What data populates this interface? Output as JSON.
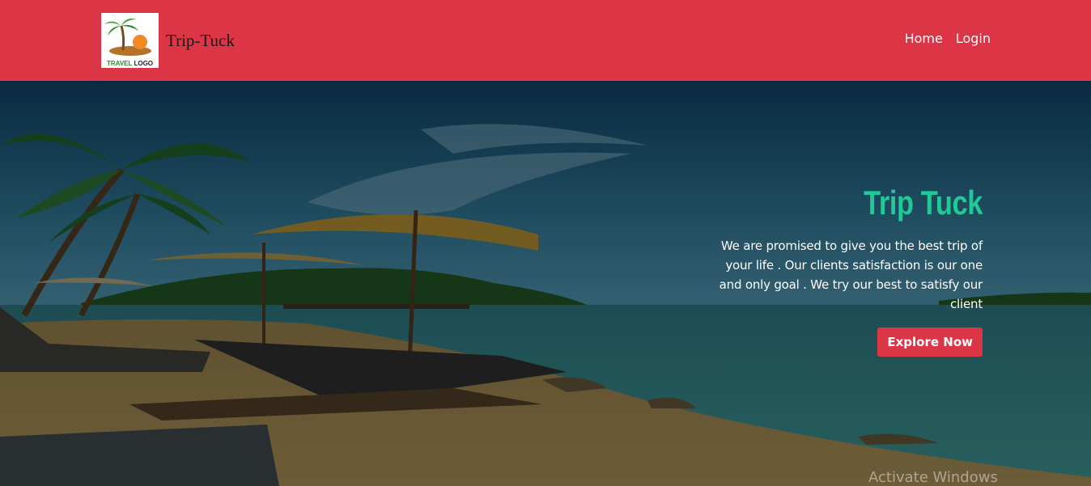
{
  "navbar": {
    "logo_text_green": "TRAVEL",
    "logo_text_dark": "LOGO",
    "brand_name": "Trip-Tuck",
    "links": [
      {
        "label": "Home"
      },
      {
        "label": "Login"
      }
    ]
  },
  "hero": {
    "title": "Trip Tuck",
    "description": "We are promised to give you the best trip of your life . Our clients satisfaction is our one and only goal . We try our best to satisfy our client",
    "button_label": "Explore Now"
  },
  "overlay": {
    "watermark": "Activate Windows"
  },
  "colors": {
    "navbar_bg": "#dc3545",
    "title_accent": "#20c997",
    "button_bg": "#dc3545"
  }
}
